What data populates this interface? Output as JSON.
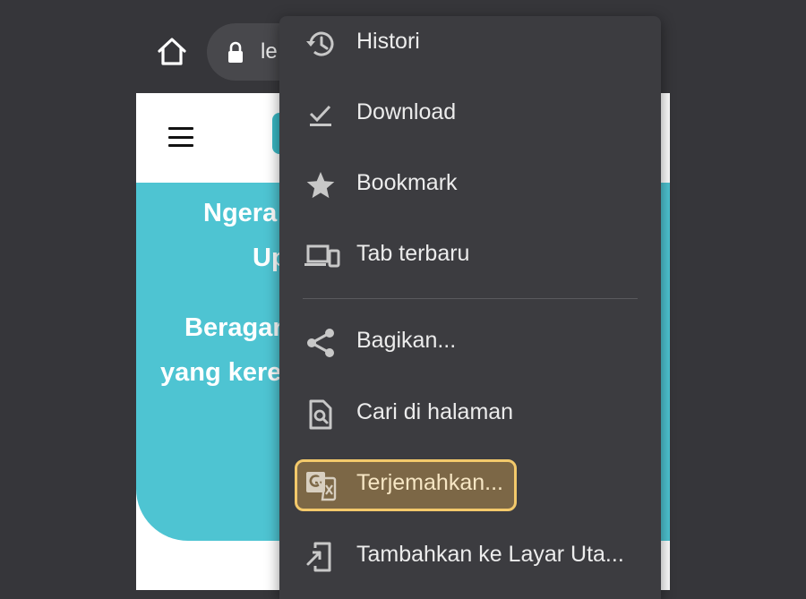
{
  "browser": {
    "url_text": "le",
    "icons": {
      "home": "home-icon",
      "lock": "lock-icon"
    }
  },
  "page": {
    "hero_lines": [
      "Ngera",
      "Up",
      "Beragar",
      "yang kere"
    ],
    "colors": {
      "hero": "#4ec4d2",
      "menu_bg": "#3c3c40",
      "highlight_border": "#f3c96b",
      "highlight_fill": "#7c6746"
    }
  },
  "menu": {
    "items": [
      {
        "label": "Histori",
        "icon": "history-icon"
      },
      {
        "label": "Download",
        "icon": "download-icon"
      },
      {
        "label": "Bookmark",
        "icon": "star-icon"
      },
      {
        "label": "Tab terbaru",
        "icon": "devices-icon"
      },
      {
        "label": "Bagikan...",
        "icon": "share-icon"
      },
      {
        "label": "Cari di halaman",
        "icon": "find-in-page-icon"
      },
      {
        "label": "Terjemahkan...",
        "icon": "translate-icon",
        "highlighted": true
      },
      {
        "label": "Tambahkan ke Layar Uta...",
        "icon": "add-to-home-icon"
      }
    ]
  }
}
